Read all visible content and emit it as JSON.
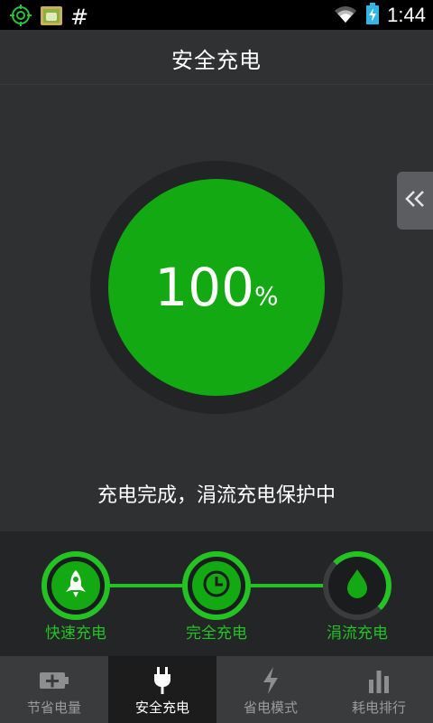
{
  "statusbar": {
    "time": "1:44",
    "icons": [
      "target-icon",
      "android-icon",
      "hash-icon",
      "wifi-icon",
      "battery-charging-icon"
    ],
    "hash_glyph": "#"
  },
  "header": {
    "title": "安全充电"
  },
  "charge": {
    "percent": "100",
    "unit": "%",
    "status": "充电完成，涓流充电保护中",
    "level": 1.0
  },
  "steps": [
    {
      "label": "快速充电",
      "icon": "rocket-icon"
    },
    {
      "label": "完全充电",
      "icon": "clock-icon"
    },
    {
      "label": "涓流充电",
      "icon": "drop-icon"
    }
  ],
  "tabs": [
    {
      "label": "节省电量",
      "icon": "battery-plus-icon",
      "active": false
    },
    {
      "label": "安全充电",
      "icon": "plug-icon",
      "active": true
    },
    {
      "label": "省电模式",
      "icon": "lightning-icon",
      "active": false
    },
    {
      "label": "耗电排行",
      "icon": "bar-chart-icon",
      "active": false
    }
  ],
  "colors": {
    "accent": "#22c322",
    "circle": "#13a913",
    "background": "#2f3032"
  }
}
